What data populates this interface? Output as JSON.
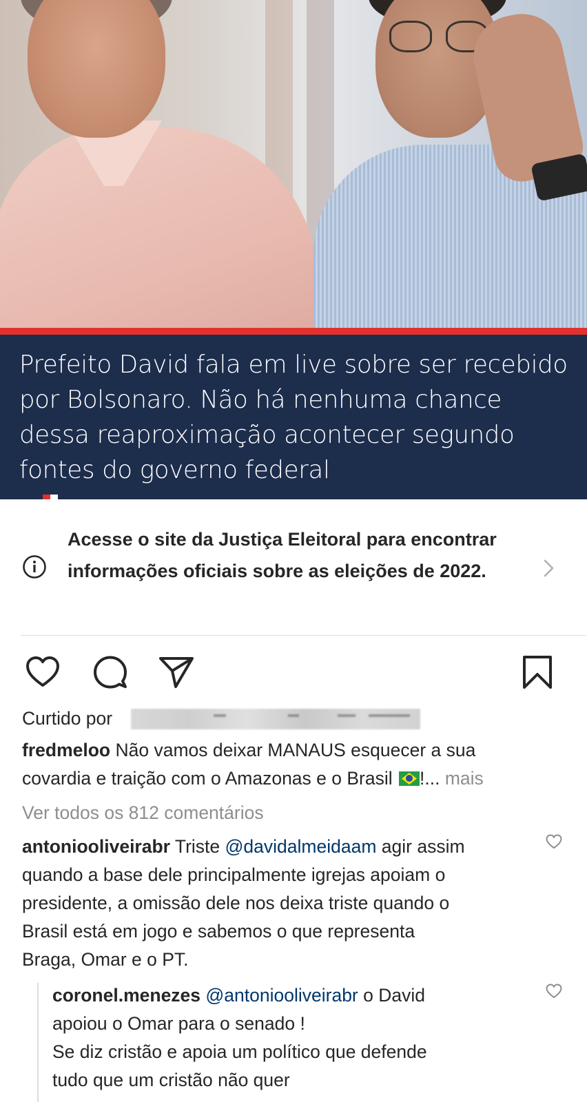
{
  "post": {
    "image_caption": "Prefeito David fala em live sobre ser recebido por Bolsonaro. Não há nenhuma chance dessa reaproximação acontecer segundo fontes do governo federal"
  },
  "election_banner": {
    "text": "Acesse o site da Justiça Eleitoral para encontrar informações oficiais sobre as eleições de 2022."
  },
  "actions": {
    "like_icon": "heart-icon",
    "comment_icon": "comment-icon",
    "share_icon": "send-icon",
    "save_icon": "bookmark-icon"
  },
  "likes": {
    "prefix": "Curtido por"
  },
  "caption": {
    "username": "fredmeloo",
    "text_line1": "Não vamos deixar MANAUS esquecer a sua",
    "text_line2": "covardia e traição com o Amazonas e o Brasil",
    "after_flag": "!...",
    "more": "mais"
  },
  "view_comments": "Ver todos os 812 comentários",
  "comments": [
    {
      "username": "antoniooliveirabr",
      "before_mention": "Triste",
      "mention": "@davidalmeidaam",
      "line1_after": "agir assim",
      "lines": [
        "quando a base dele principalmente igrejas apoiam o",
        "presidente, a omissão dele nos deixa triste quando o",
        "Brasil está em jogo e sabemos o que representa",
        "Braga,  Omar e o PT."
      ]
    },
    {
      "username": "coronel.menezes",
      "mention": "@antoniooliveirabr",
      "line1_after": "o David",
      "lines": [
        "apoiou o Omar para o senado !",
        "Se diz cristão e apoia um político que defende",
        "tudo que um cristão não quer"
      ]
    }
  ],
  "colors": {
    "caption_panel": "#1d2d4c",
    "accent_red": "#e2302d",
    "text": "#262626",
    "muted": "#8e8e8e",
    "mention": "#00376b"
  }
}
